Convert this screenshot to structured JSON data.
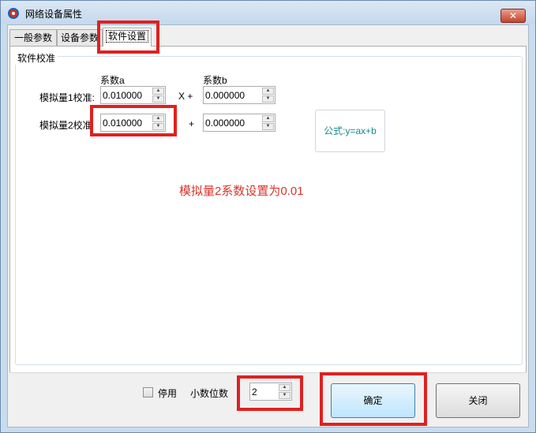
{
  "window": {
    "title": "网络设备属性",
    "close_label": "✕"
  },
  "tabs": [
    {
      "label": "一般参数"
    },
    {
      "label": "设备参数"
    },
    {
      "label": "软件设置"
    }
  ],
  "group": {
    "title": "软件校准",
    "col_a_header": "系数a",
    "col_b_header": "系数b",
    "rows": [
      {
        "label": "模拟量1校准:",
        "a_value": "0.010000",
        "op": "X +",
        "b_value": "0.000000"
      },
      {
        "label": "模拟量2校准",
        "a_value": "0.010000",
        "op": "+",
        "b_value": "0.000000"
      }
    ],
    "formula": "公式:y=ax+b"
  },
  "annotation": "模拟量2系数设置为0.01",
  "bottom": {
    "disable_label": "停用",
    "disable_checked": false,
    "decimals_label": "小数位数",
    "decimals_value": "2",
    "ok_label": "确定",
    "close_label": "关闭"
  },
  "colors": {
    "highlight": "#e02020",
    "annotation": "#d9342b",
    "formula": "#1a8a8a"
  }
}
